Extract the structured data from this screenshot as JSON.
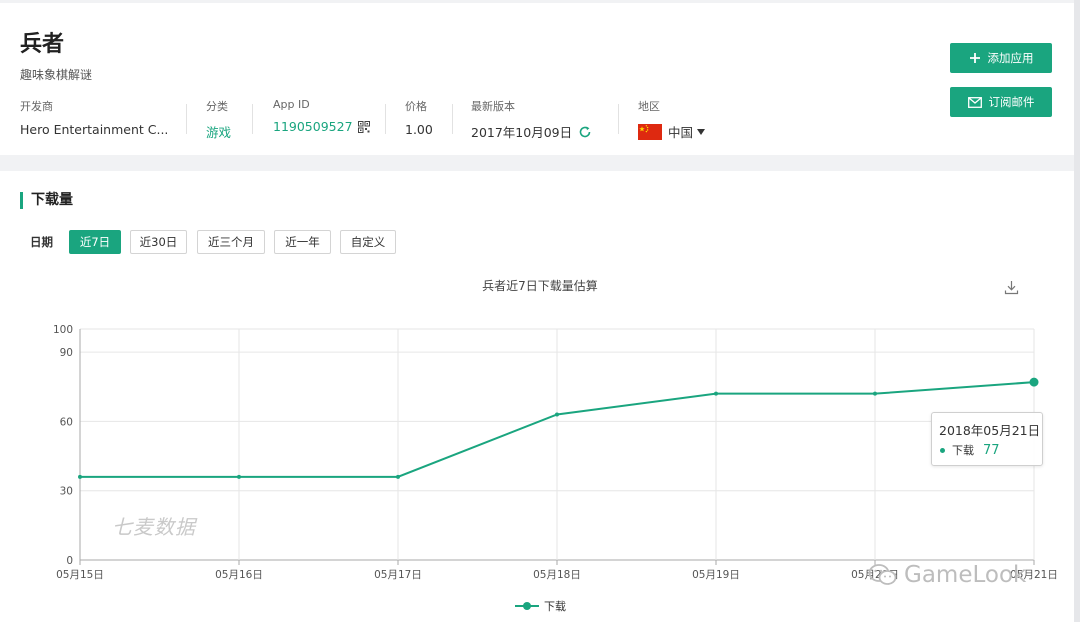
{
  "app": {
    "name": "兵者",
    "subtitle": "趣味象棋解谜"
  },
  "info": {
    "developer": {
      "label": "开发商",
      "value": "Hero Entertainment C..."
    },
    "category": {
      "label": "分类",
      "value": "游戏"
    },
    "app_id": {
      "label": "App ID",
      "value": "1190509527"
    },
    "price": {
      "label": "价格",
      "value": "1.00"
    },
    "version": {
      "label": "最新版本",
      "value": "2017年10月09日"
    },
    "region": {
      "label": "地区",
      "value": "中国"
    }
  },
  "buttons": {
    "add_app": "添加应用",
    "subscribe": "订阅邮件"
  },
  "section": {
    "title": "下载量"
  },
  "date_filter": {
    "label": "日期",
    "options": [
      "近7日",
      "近30日",
      "近三个月",
      "近一年",
      "自定义"
    ],
    "active_index": 0
  },
  "chart_title": "兵者近7日下载量估算",
  "tooltip": {
    "date": "2018年05月21日",
    "series_name": "下载",
    "value": "77"
  },
  "watermarks": {
    "qimai": "七麦数据",
    "gamelook": "GameLook"
  },
  "colors": {
    "accent": "#1aa57f",
    "flag_red": "#de2910",
    "flag_yellow": "#ffde00"
  },
  "chart_data": {
    "type": "line",
    "title": "兵者近7日下载量估算",
    "x": [
      "05月15日",
      "05月16日",
      "05月17日",
      "05月18日",
      "05月19日",
      "05月20日",
      "05月21日"
    ],
    "series": [
      {
        "name": "下载",
        "values": [
          36,
          36,
          36,
          63,
          72,
          72,
          77
        ]
      }
    ],
    "y_ticks": [
      0,
      30,
      60,
      90,
      100
    ],
    "ylim": [
      0,
      100
    ],
    "grid": true,
    "legend": "bottom-center",
    "xlabel": "",
    "ylabel": ""
  }
}
